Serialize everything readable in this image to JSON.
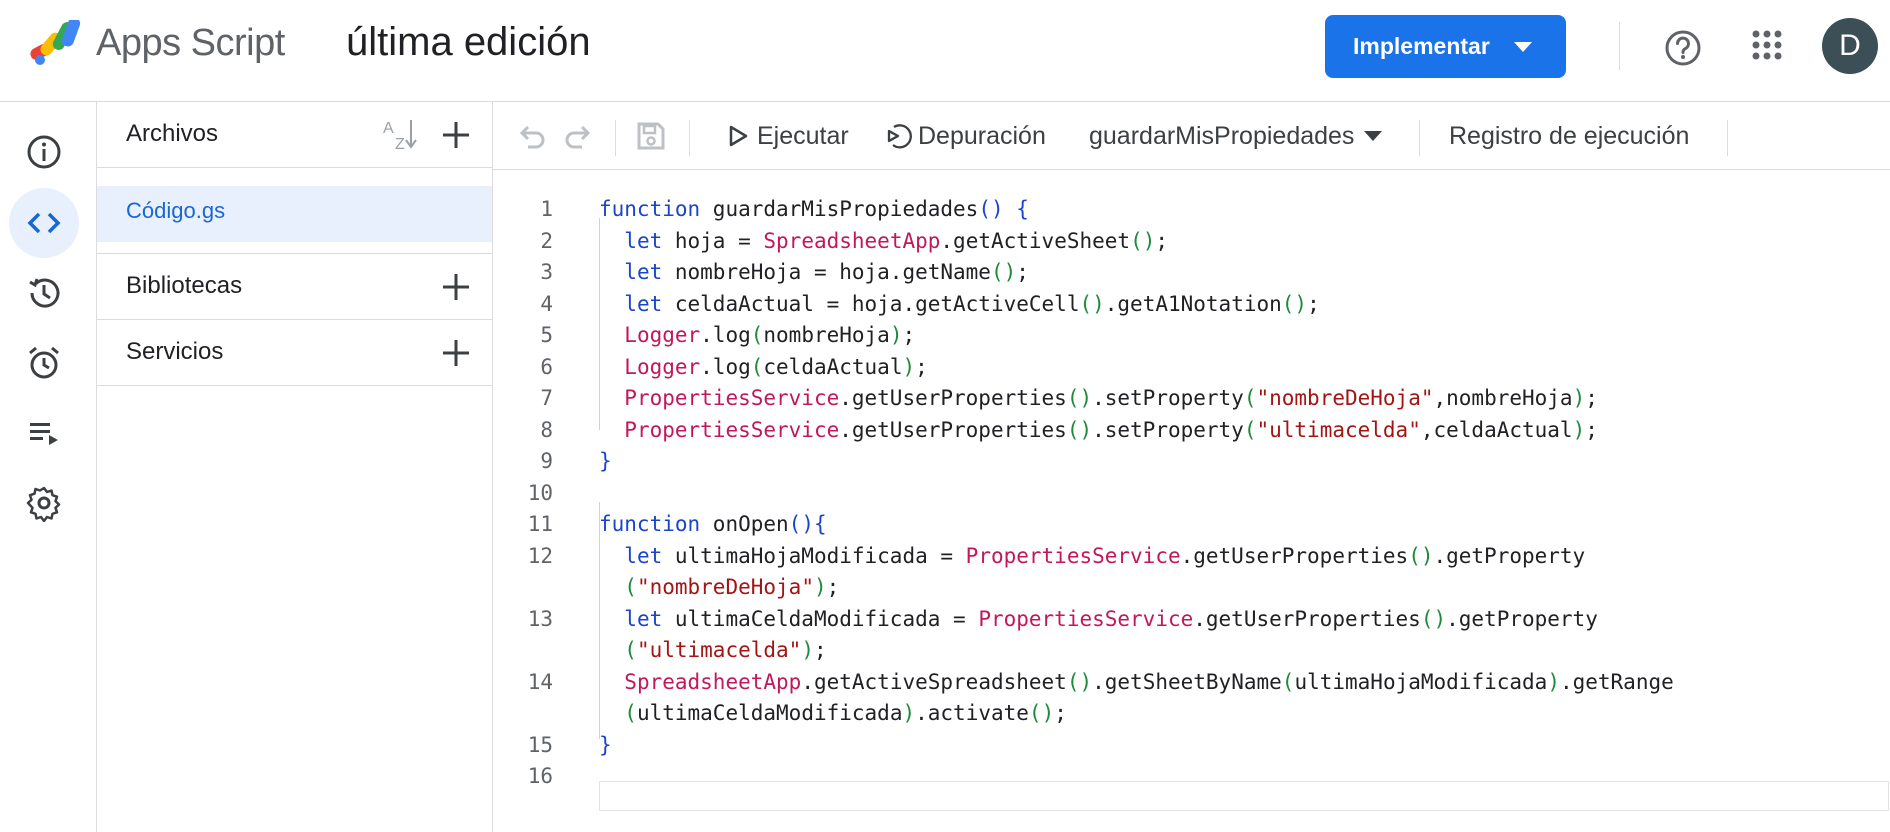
{
  "header": {
    "app_name": "Apps Script",
    "project_title": "última edición",
    "deploy_label": "Implementar",
    "avatar_letter": "D"
  },
  "files_panel": {
    "files_title": "Archivos",
    "active_file": "Código.gs",
    "libraries_title": "Bibliotecas",
    "services_title": "Servicios"
  },
  "toolbar": {
    "run_label": "Ejecutar",
    "debug_label": "Depuración",
    "function_name": "guardarMisPropiedades",
    "log_label": "Registro de ejecución"
  },
  "colors": {
    "accent": "#1a73e8",
    "keyword": "#1a44c9",
    "class": "#c2185b",
    "string": "#a31515",
    "paren": "#1e8a3a"
  },
  "code_lines": [
    {
      "n": "1",
      "segments": [
        [
          "kw",
          "function"
        ],
        [
          "t",
          " guardarMisPropiedades"
        ],
        [
          "kw",
          "()"
        ],
        [
          "t",
          " "
        ],
        [
          "kw",
          "{"
        ]
      ]
    },
    {
      "n": "2",
      "segments": [
        [
          "t",
          "  "
        ],
        [
          "kw",
          "let"
        ],
        [
          "t",
          " hoja = "
        ],
        [
          "cls",
          "SpreadsheetApp"
        ],
        [
          "t",
          ".getActiveSheet"
        ],
        [
          "par",
          "()"
        ],
        [
          "t",
          ";"
        ]
      ]
    },
    {
      "n": "3",
      "segments": [
        [
          "t",
          "  "
        ],
        [
          "kw",
          "let"
        ],
        [
          "t",
          " nombreHoja = hoja.getName"
        ],
        [
          "par",
          "()"
        ],
        [
          "t",
          ";"
        ]
      ]
    },
    {
      "n": "4",
      "segments": [
        [
          "t",
          "  "
        ],
        [
          "kw",
          "let"
        ],
        [
          "t",
          " celdaActual = hoja.getActiveCell"
        ],
        [
          "par",
          "()"
        ],
        [
          "t",
          ".getA1Notation"
        ],
        [
          "par",
          "()"
        ],
        [
          "t",
          ";"
        ]
      ]
    },
    {
      "n": "5",
      "segments": [
        [
          "t",
          "  "
        ],
        [
          "cls",
          "Logger"
        ],
        [
          "t",
          ".log"
        ],
        [
          "par",
          "("
        ],
        [
          "t",
          "nombreHoja"
        ],
        [
          "par",
          ")"
        ],
        [
          "t",
          ";"
        ]
      ]
    },
    {
      "n": "6",
      "segments": [
        [
          "t",
          "  "
        ],
        [
          "cls",
          "Logger"
        ],
        [
          "t",
          ".log"
        ],
        [
          "par",
          "("
        ],
        [
          "t",
          "celdaActual"
        ],
        [
          "par",
          ")"
        ],
        [
          "t",
          ";"
        ]
      ]
    },
    {
      "n": "7",
      "segments": [
        [
          "t",
          "  "
        ],
        [
          "cls",
          "PropertiesService"
        ],
        [
          "t",
          ".getUserProperties"
        ],
        [
          "par",
          "()"
        ],
        [
          "t",
          ".setProperty"
        ],
        [
          "par",
          "("
        ],
        [
          "str",
          "\"nombreDeHoja\""
        ],
        [
          "t",
          ",nombreHoja"
        ],
        [
          "par",
          ")"
        ],
        [
          "t",
          ";"
        ]
      ]
    },
    {
      "n": "8",
      "segments": [
        [
          "t",
          "  "
        ],
        [
          "cls",
          "PropertiesService"
        ],
        [
          "t",
          ".getUserProperties"
        ],
        [
          "par",
          "()"
        ],
        [
          "t",
          ".setProperty"
        ],
        [
          "par",
          "("
        ],
        [
          "str",
          "\"ultimacelda\""
        ],
        [
          "t",
          ",celdaActual"
        ],
        [
          "par",
          ")"
        ],
        [
          "t",
          ";"
        ]
      ]
    },
    {
      "n": "9",
      "segments": [
        [
          "kw",
          "}"
        ]
      ]
    },
    {
      "n": "10",
      "segments": []
    },
    {
      "n": "11",
      "segments": [
        [
          "kw",
          "function"
        ],
        [
          "t",
          " onOpen"
        ],
        [
          "kw",
          "(){"
        ]
      ]
    },
    {
      "n": "12",
      "segments": [
        [
          "t",
          "  "
        ],
        [
          "kw",
          "let"
        ],
        [
          "t",
          " ultimaHojaModificada = "
        ],
        [
          "cls",
          "PropertiesService"
        ],
        [
          "t",
          ".getUserProperties"
        ],
        [
          "par",
          "()"
        ],
        [
          "t",
          ".getProperty"
        ]
      ]
    },
    {
      "n": "",
      "segments": [
        [
          "t",
          "  "
        ],
        [
          "par",
          "("
        ],
        [
          "str",
          "\"nombreDeHoja\""
        ],
        [
          "par",
          ")"
        ],
        [
          "t",
          ";"
        ]
      ]
    },
    {
      "n": "13",
      "segments": [
        [
          "t",
          "  "
        ],
        [
          "kw",
          "let"
        ],
        [
          "t",
          " ultimaCeldaModificada = "
        ],
        [
          "cls",
          "PropertiesService"
        ],
        [
          "t",
          ".getUserProperties"
        ],
        [
          "par",
          "()"
        ],
        [
          "t",
          ".getProperty"
        ]
      ]
    },
    {
      "n": "",
      "segments": [
        [
          "t",
          "  "
        ],
        [
          "par",
          "("
        ],
        [
          "str",
          "\"ultimacelda\""
        ],
        [
          "par",
          ")"
        ],
        [
          "t",
          ";"
        ]
      ]
    },
    {
      "n": "14",
      "segments": [
        [
          "t",
          "  "
        ],
        [
          "cls",
          "SpreadsheetApp"
        ],
        [
          "t",
          ".getActiveSpreadsheet"
        ],
        [
          "par",
          "()"
        ],
        [
          "t",
          ".getSheetByName"
        ],
        [
          "par",
          "("
        ],
        [
          "t",
          "ultimaHojaModificada"
        ],
        [
          "par",
          ")"
        ],
        [
          "t",
          ".getRange"
        ]
      ]
    },
    {
      "n": "",
      "segments": [
        [
          "t",
          "  "
        ],
        [
          "par",
          "("
        ],
        [
          "t",
          "ultimaCeldaModificada"
        ],
        [
          "par",
          ")"
        ],
        [
          "t",
          ".activate"
        ],
        [
          "par",
          "()"
        ],
        [
          "t",
          ";"
        ]
      ]
    },
    {
      "n": "15",
      "segments": [
        [
          "kw",
          "}"
        ]
      ]
    },
    {
      "n": "16",
      "segments": []
    }
  ]
}
